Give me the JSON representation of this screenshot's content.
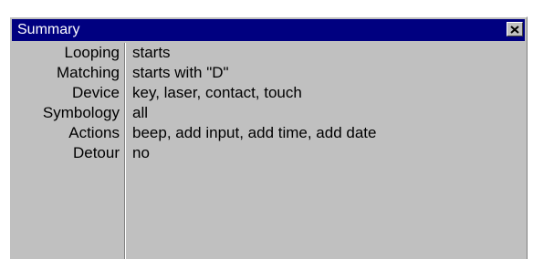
{
  "window": {
    "title": "Summary",
    "close_icon": "close-icon"
  },
  "rows": [
    {
      "label": "Looping",
      "value": "starts"
    },
    {
      "label": "Matching",
      "value": "starts with \"D\""
    },
    {
      "label": "Device",
      "value": "key, laser, contact, touch"
    },
    {
      "label": "Symbology",
      "value": "all"
    },
    {
      "label": "Actions",
      "value": "beep, add input, add time, add date"
    },
    {
      "label": "Detour",
      "value": "no"
    }
  ],
  "colors": {
    "titlebar": "#000080",
    "title_text": "#ffffff",
    "panel": "#c0c0c0"
  }
}
